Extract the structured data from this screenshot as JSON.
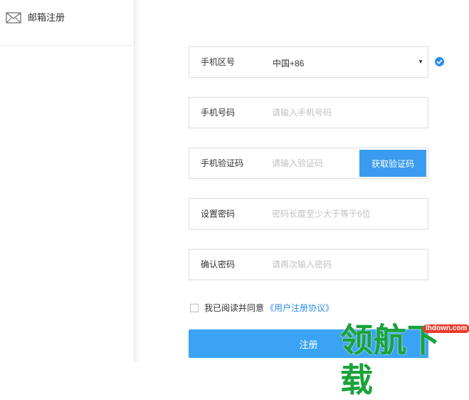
{
  "sidebar": {
    "items": [
      {
        "label": "邮箱注册",
        "icon": "envelope-icon"
      }
    ]
  },
  "form": {
    "phone_area": {
      "label": "手机区号",
      "selected": "中国+86"
    },
    "phone_number": {
      "label": "手机号码",
      "placeholder": "请输入手机号码"
    },
    "sms_code": {
      "label": "手机验证码",
      "placeholder": "请输入验证码",
      "button_label": "获取验证码"
    },
    "password": {
      "label": "设置密码",
      "placeholder": "密码长度至少大于等于6位"
    },
    "confirm_password": {
      "label": "确认密码",
      "placeholder": "请再次输入密码"
    },
    "agreement": {
      "text": "我已阅读并同意",
      "link": "《用户注册协议》"
    },
    "submit_label": "注册"
  },
  "watermark": {
    "text": "领航下载",
    "url": "lhdown.com"
  },
  "colors": {
    "accent": "#3aa3f3",
    "link": "#2e8ceb",
    "watermark": "#19a33a"
  }
}
